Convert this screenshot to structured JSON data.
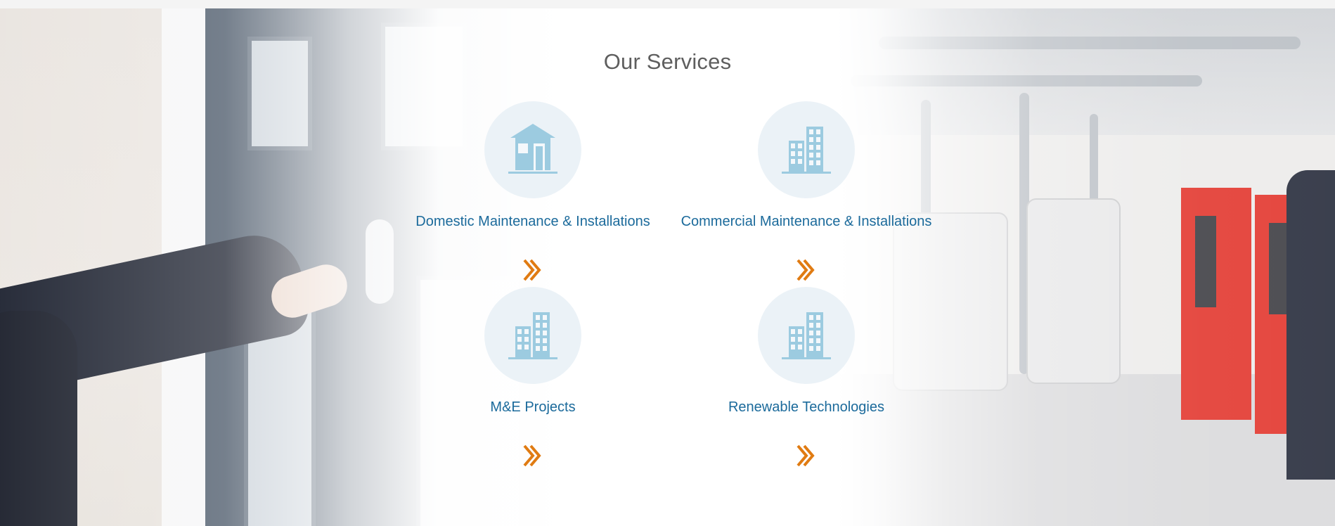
{
  "section": {
    "title": "Our Services"
  },
  "services": [
    {
      "label": "Domestic Maintenance & Installations",
      "icon": "house-icon"
    },
    {
      "label": "Commercial Maintenance & Installations",
      "icon": "building-icon"
    },
    {
      "label": "M&E Projects",
      "icon": "building-icon"
    },
    {
      "label": "Renewable Technologies",
      "icon": "building-icon"
    }
  ],
  "colors": {
    "title": "#5e5e5e",
    "label": "#1b6a9b",
    "icon": "#9ccbe0",
    "icon_circle": "#e8f0f6",
    "arrow": "#e07b12"
  }
}
